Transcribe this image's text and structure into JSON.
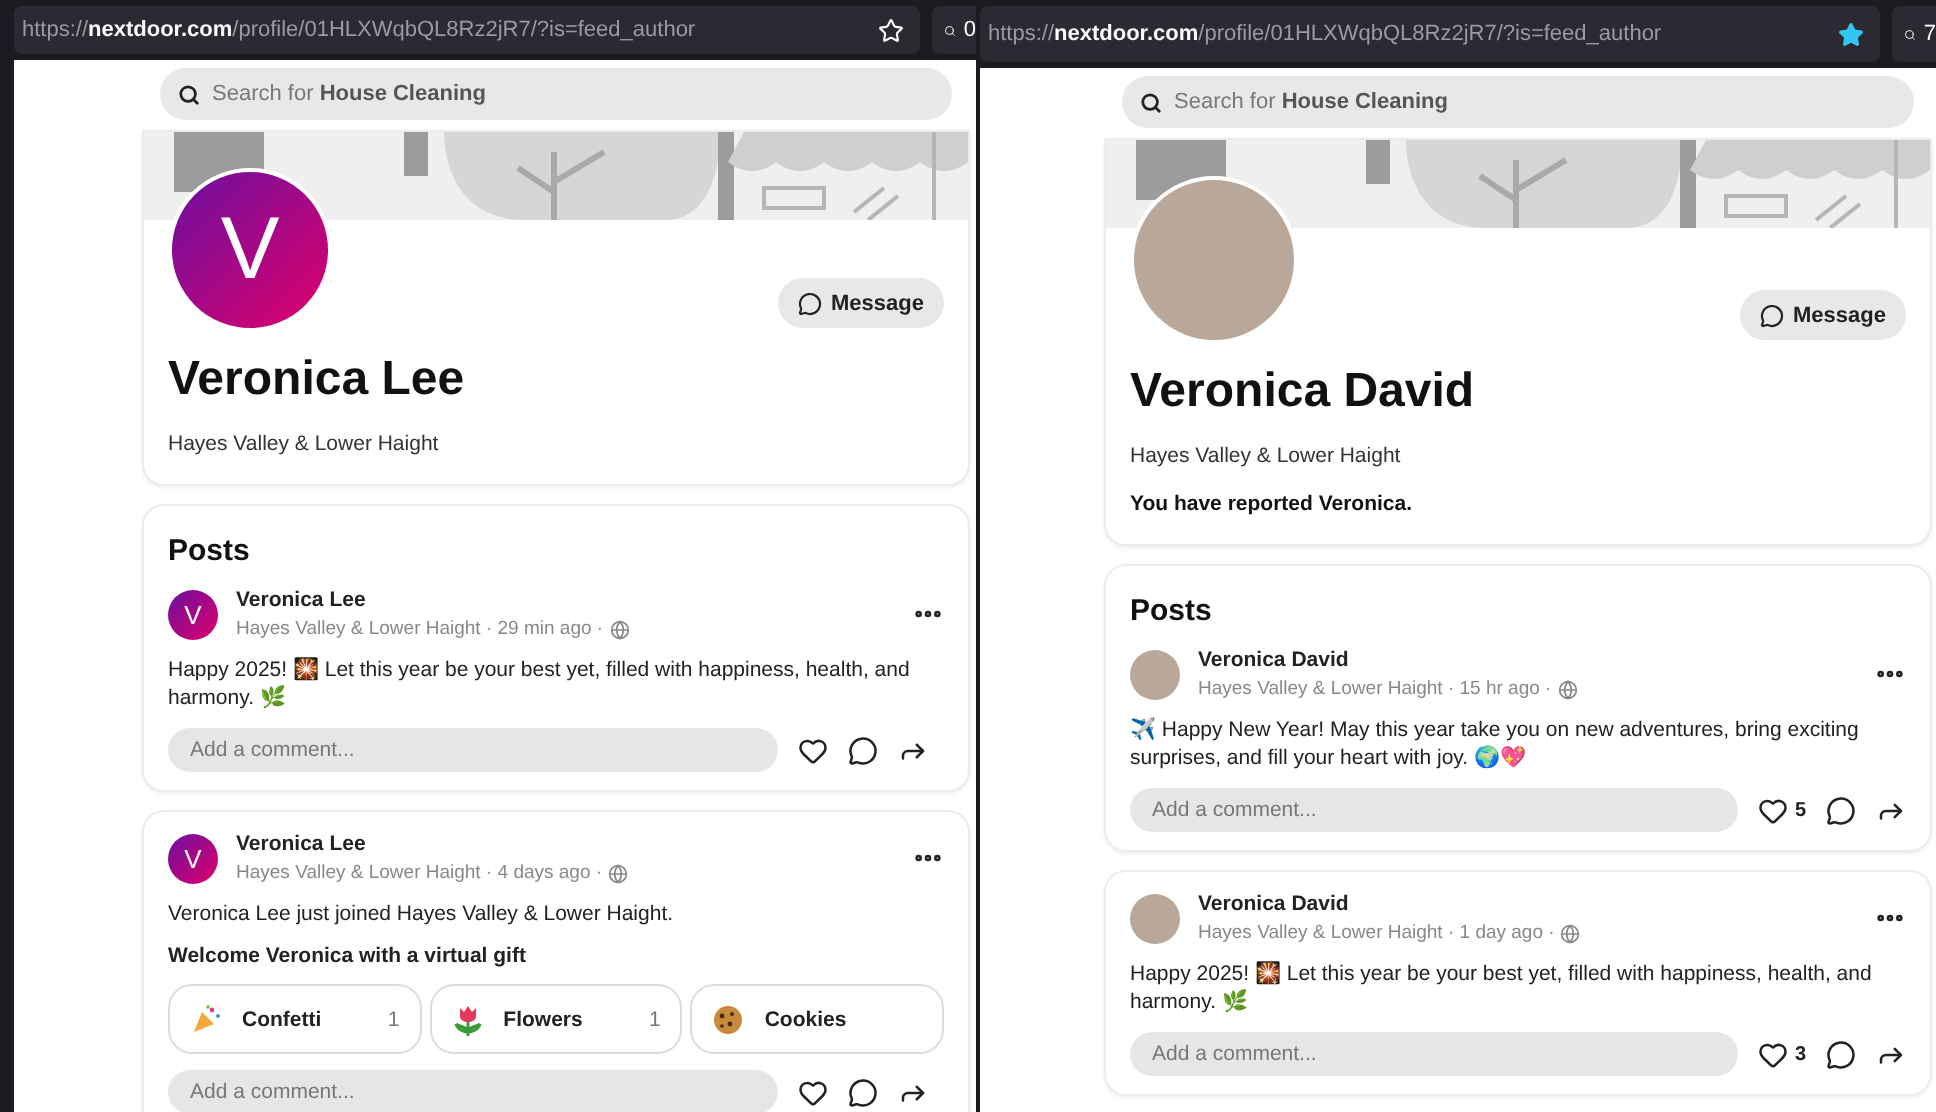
{
  "panels": [
    {
      "address_bar": {
        "url": "https://**nextdoor.com**/profile/01HLXWqbQL8Rz2jR7/?is=feed_author",
        "starred": false,
        "search_text": "0"
      },
      "search": {
        "placeholder": "Search for **House Cleaning**"
      },
      "profile": {
        "avatar": {
          "kind": "letter",
          "letter": "V"
        },
        "message_button": "Message",
        "name": "Veronica Lee",
        "neighborhood": "Hayes Valley & Lower Haight"
      },
      "posts_heading": "Posts",
      "posts": [
        {
          "avatar": {
            "kind": "letter",
            "letter": "V"
          },
          "author": "Veronica Lee",
          "meta": "Hayes Valley & Lower Haight · 29 min ago ·",
          "text": "Happy 2025! 🎇 Let this year be your best yet, filled with happiness, health, and harmony. 🌿",
          "comment_placeholder": "Add a comment..."
        },
        {
          "avatar": {
            "kind": "letter",
            "letter": "V"
          },
          "author": "Veronica Lee",
          "meta": "Hayes Valley & Lower Haight · 4 days ago ·",
          "text": "Veronica Lee just joined Hayes Valley & Lower Haight.",
          "gift_prompt": "Welcome Veronica with a virtual gift",
          "gifts": [
            {
              "label": "Confetti",
              "count": "1"
            },
            {
              "label": "Flowers",
              "count": "1"
            },
            {
              "label": "Cookies"
            }
          ],
          "comment_placeholder": "Add a comment..."
        }
      ]
    },
    {
      "address_bar": {
        "url": "https://**nextdoor.com**/profile/01HLXWqbQL8Rz2jR7/?is=feed_author",
        "starred": true,
        "search_text": "7"
      },
      "search": {
        "placeholder": "Search for **House Cleaning**"
      },
      "profile": {
        "avatar": {
          "kind": "photo"
        },
        "message_button": "Message",
        "name": "Veronica David",
        "neighborhood": "Hayes Valley & Lower Haight",
        "notice": "You have reported Veronica."
      },
      "posts_heading": "Posts",
      "posts": [
        {
          "avatar": {
            "kind": "photo"
          },
          "author": "Veronica David",
          "meta": "Hayes Valley & Lower Haight · 15 hr ago ·",
          "text": "✈️ Happy New Year! May this year take you on new adventures, bring exciting surprises, and fill your heart with joy. 🌍💖",
          "likes": "5",
          "comment_placeholder": "Add a comment..."
        },
        {
          "avatar": {
            "kind": "photo"
          },
          "author": "Veronica David",
          "meta": "Hayes Valley & Lower Haight · 1 day ago ·",
          "text": "Happy 2025! 🎇 Let this year be your best yet, filled with happiness, health, and harmony. 🌿",
          "likes": "3",
          "comment_placeholder": "Add a comment..."
        }
      ]
    }
  ]
}
